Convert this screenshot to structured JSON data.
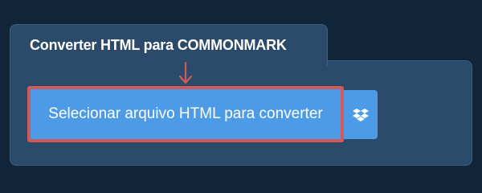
{
  "panel": {
    "title": "Converter HTML para COMMONMARK"
  },
  "actions": {
    "select_file_label": "Selecionar arquivo HTML para converter",
    "dropbox_icon": "dropbox-icon"
  },
  "annotations": {
    "arrow_icon": "arrow-down-icon"
  },
  "colors": {
    "background": "#10253a",
    "panel": "#2b4a6a",
    "button": "#4d9be6",
    "highlight": "#d05a5a"
  }
}
